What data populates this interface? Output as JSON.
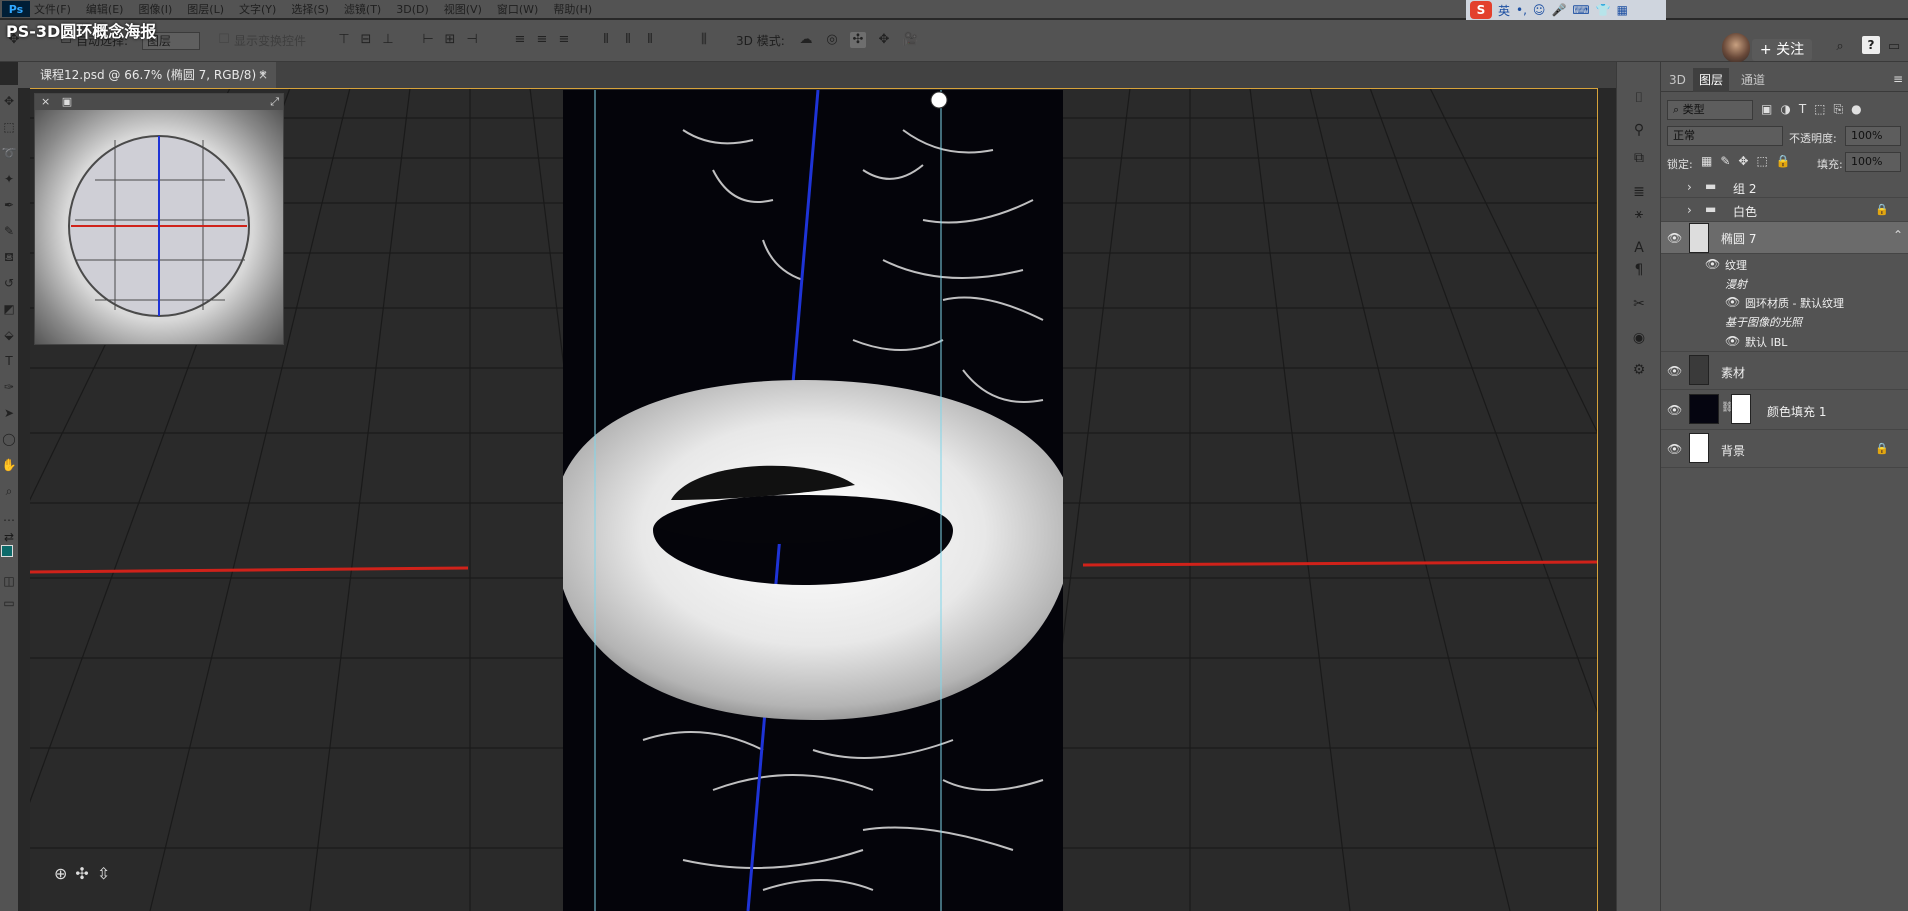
{
  "app": {
    "logo": "Ps",
    "video_title": "PS-3D圆环概念海报"
  },
  "menu": [
    "文件(F)",
    "编辑(E)",
    "图像(I)",
    "图层(L)",
    "文字(Y)",
    "选择(S)",
    "滤镜(T)",
    "3D(D)",
    "视图(V)",
    "窗口(W)",
    "帮助(H)"
  ],
  "ime": {
    "sogou_label": "S",
    "lang": "英"
  },
  "options": {
    "auto_select_label": "自动选择:",
    "auto_select_value": "图层",
    "show_transform_label": "显示变换控件",
    "mode_3d_label": "3D 模式:"
  },
  "follow": {
    "label": "+ 关注"
  },
  "help": {
    "label": "?"
  },
  "document": {
    "tab_label": "课程12.psd @ 66.7% (椭圆 7, RGB/8) *",
    "close_symbol": "×"
  },
  "minimap": {
    "close_symbol": "×"
  },
  "canvas": {
    "guide_color": "#7fd6ea",
    "axis_red": "#d0221a",
    "axis_blue": "#1e33d6",
    "frame_color": "#d6a23a"
  },
  "layers_panel": {
    "tabs": [
      {
        "label": "3D"
      },
      {
        "label": "图层"
      },
      {
        "label": "通道"
      }
    ],
    "filter": {
      "label": "类型"
    },
    "blend": {
      "value": "正常"
    },
    "opacity": {
      "label": "不透明度:",
      "value": "100%"
    },
    "lock": {
      "label": "锁定:"
    },
    "fill": {
      "label": "填充:",
      "value": "100%"
    },
    "layers": [
      {
        "name": "组 2",
        "type": "group",
        "visible": false
      },
      {
        "name": "白色",
        "type": "group",
        "visible": false,
        "locked": true
      },
      {
        "name": "椭圆 7",
        "type": "3d",
        "visible": true,
        "selected": true
      },
      {
        "name": "纹理",
        "type": "sub",
        "visible": true
      },
      {
        "name": "漫射",
        "type": "subheader"
      },
      {
        "name": "圆环材质 - 默认纹理",
        "type": "subsub",
        "visible": true
      },
      {
        "name": "基于图像的光照",
        "type": "subheader"
      },
      {
        "name": "默认 IBL",
        "type": "subsub",
        "visible": true
      },
      {
        "name": "素材",
        "type": "image",
        "visible": true
      },
      {
        "name": "颜色填充 1",
        "type": "fill",
        "visible": true
      },
      {
        "name": "背景",
        "type": "bg",
        "visible": true,
        "locked": true
      }
    ]
  }
}
